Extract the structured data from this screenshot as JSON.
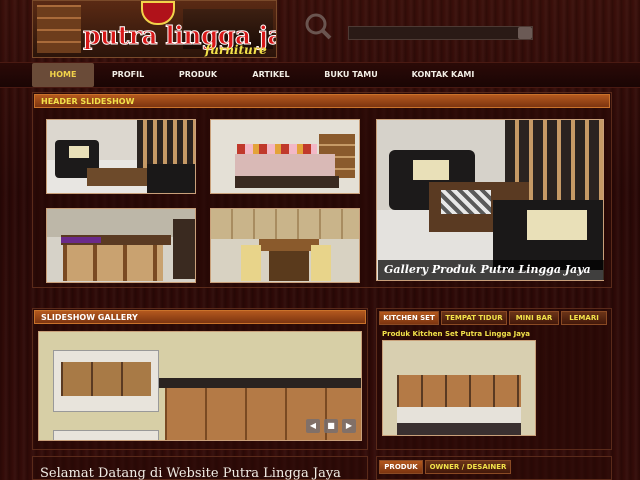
{
  "header": {
    "brand": "putra lingga jaya",
    "brand_sub": "furniture",
    "search_placeholder": ""
  },
  "nav": {
    "items": [
      "HOME",
      "PROFIL",
      "PRODUK",
      "ARTIKEL",
      "BUKU TAMU",
      "KONTAK KAMI"
    ],
    "active": "HOME"
  },
  "header_slideshow": {
    "title": "HEADER SLIDESHOW",
    "caption": "Gallery Produk Putra Lingga Jaya"
  },
  "slideshow_gallery": {
    "title": "SLIDESHOW GALLERY",
    "controls": [
      "prev",
      "stop",
      "next"
    ]
  },
  "product_tabs": {
    "tabs": [
      "KITCHEN SET",
      "TEMPAT TIDUR",
      "MINI BAR",
      "LEMARI"
    ],
    "active": "KITCHEN SET",
    "caption": "Produk Kitchen Set Putra Lingga Jaya"
  },
  "bottom_tabs": {
    "tabs": [
      "PRODUK",
      "OWNER / DESAINER"
    ],
    "active": "PRODUK"
  },
  "welcome": {
    "text": "Selamat Datang di Website Putra Lingga Jaya"
  },
  "colors": {
    "accent": "#f2e24a",
    "bar": "#b4581e",
    "background": "#2a0806"
  }
}
